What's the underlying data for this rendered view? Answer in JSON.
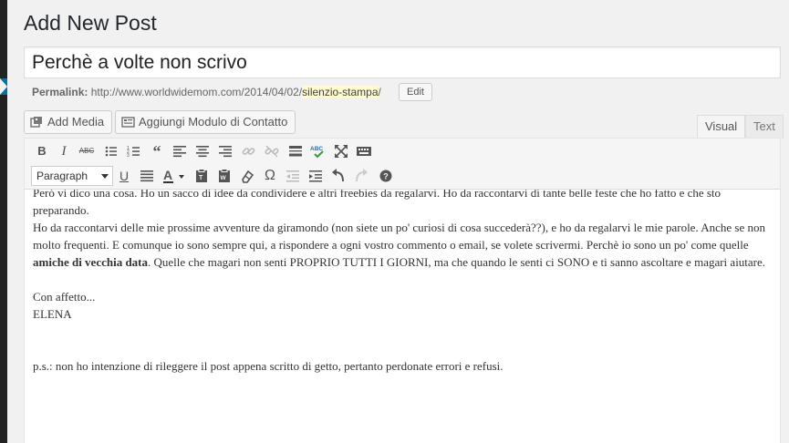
{
  "page": {
    "heading": "Add New Post",
    "post_title": "Perchè a volte non scrivo"
  },
  "permalink": {
    "label": "Permalink:",
    "base": "http://www.worldwidemom.com/2014/04/02/",
    "slug": "silenzio-stampa",
    "trailing": "/",
    "edit_label": "Edit"
  },
  "media_buttons": {
    "add_media": "Add Media",
    "contact_form": "Aggiungi Modulo di Contatto"
  },
  "editor_tabs": {
    "visual": "Visual",
    "text": "Text"
  },
  "toolbar": {
    "format_select": "Paragraph",
    "row1_icons": [
      "bold-icon",
      "italic-icon",
      "strikethrough-icon",
      "bullet-list-icon",
      "numbered-list-icon",
      "blockquote-icon",
      "align-left-icon",
      "align-center-icon",
      "align-right-icon",
      "insert-link-icon",
      "unlink-icon",
      "read-more-icon",
      "spellcheck-icon",
      "fullscreen-icon",
      "toolbar-toggle-icon"
    ],
    "row2_icons": [
      "underline-icon",
      "justify-icon",
      "text-color-icon",
      "paste-text-icon",
      "paste-word-icon",
      "clear-formatting-icon",
      "special-character-icon",
      "outdent-icon",
      "indent-icon",
      "undo-icon",
      "redo-icon",
      "help-icon"
    ]
  },
  "content": {
    "line_cut": "Però vi dico una cosa. Ho un sacco di idee da condividere e altri freebies da regalarvi. Ho da raccontarvi di tante belle feste che ho fatto e che sto preparando.",
    "para2_a": "Ho da raccontarvi delle mie prossime avventure da giramondo (non siete un po' curiosi di cosa succederà??), e ho da regalarvi le mie parole. Anche se non molto frequenti. E comunque io sono sempre qui, a rispondere a ogni vostro commento o email, se volete scrivermi. Perchè io sono un po' come quelle ",
    "para2_bold": "amiche di vecchia data",
    "para2_b": ". Quelle che magari non senti PROPRIO TUTTI I GIORNI, ma che quando le senti ci SONO e ti sanno ascoltare e magari aiutare.",
    "signoff_1": "Con affetto...",
    "signoff_2": "ELENA",
    "ps": "p.s.: non ho intenzione di rileggere il post appena scritto di getto, pertanto perdonate errori e refusi."
  },
  "colors": {
    "admin_bg": "#f1f1f1",
    "slug_highlight": "#fffbcc",
    "spellcheck_underline": "#dd0000"
  }
}
